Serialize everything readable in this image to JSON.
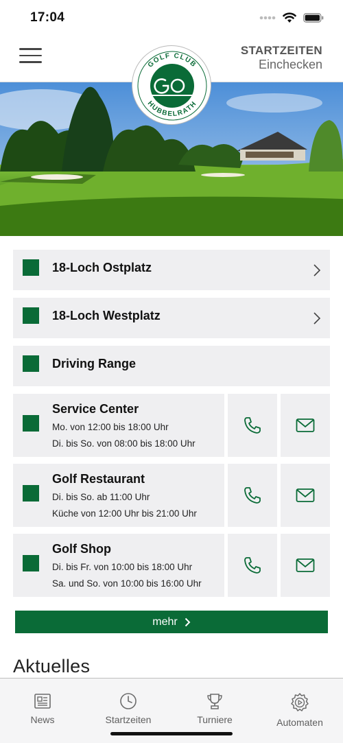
{
  "status": {
    "time": "17:04"
  },
  "header": {
    "start_label": "STARTZEITEN",
    "checkin_label": "Einchecken",
    "logo_top": "GOLF CLUB",
    "logo_bottom": "HUBBELRATH"
  },
  "courses": [
    {
      "label": "18-Loch Ostplatz",
      "has_arrow": true
    },
    {
      "label": "18-Loch Westplatz",
      "has_arrow": true
    },
    {
      "label": "Driving Range",
      "has_arrow": false
    }
  ],
  "contacts": [
    {
      "title": "Service Center",
      "line1": "Mo. von 12:00 bis 18:00 Uhr",
      "line2": "Di. bis So. von 08:00 bis 18:00 Uhr"
    },
    {
      "title": "Golf Restaurant",
      "line1": "Di. bis So. ab 11:00 Uhr",
      "line2": "Küche von 12:00 Uhr bis 21:00 Uhr"
    },
    {
      "title": "Golf Shop",
      "line1": "Di. bis Fr. von 10:00 bis 18:00 Uhr",
      "line2": "Sa. und So. von 10:00 bis 16:00 Uhr"
    }
  ],
  "more_button": "mehr",
  "news_heading": "Aktuelles",
  "tabs": [
    {
      "label": "News",
      "icon": "newspaper-icon"
    },
    {
      "label": "Startzeiten",
      "icon": "clock-icon"
    },
    {
      "label": "Turniere",
      "icon": "trophy-icon"
    },
    {
      "label": "Automaten",
      "icon": "gear-play-icon"
    }
  ],
  "colors": {
    "brand_green": "#0a6b37",
    "row_bg": "#efeff1"
  }
}
